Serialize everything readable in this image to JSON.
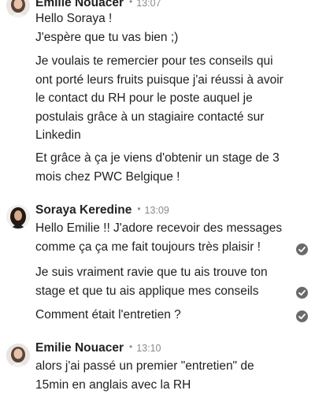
{
  "messages": [
    {
      "sender": "Emilie Nouacer",
      "time": "13:07",
      "lines": [
        "Hello Soraya !",
        "J'espère que tu vas bien ;)",
        "Je voulais te remercier pour tes conseils qui",
        "ont porté leurs fruits puisque j'ai réussi à avoir",
        "le contact du RH pour le poste auquel je",
        "postulais grâce à un stagiaire contacté sur",
        "Linkedin",
        "Et grâce à ça je viens d'obtenir un stage de 3",
        "mois chez PWC Belgique !"
      ]
    },
    {
      "sender": "Soraya Keredine",
      "time": "13:09",
      "lines": [
        "Hello Emilie !! J'adore recevoir des messages",
        "comme ça ça me fait toujours très plaisir !",
        "Je suis vraiment ravie que tu ais trouve ton",
        "stage et que tu ais applique mes conseils",
        "Comment était l'entretien ?"
      ]
    },
    {
      "sender": "Emilie Nouacer",
      "time": "13:10",
      "lines": [
        "alors j'ai passé un premier \"entretien\" de",
        "15min en anglais avec la RH"
      ]
    }
  ],
  "separator": "•",
  "icons": {
    "avatar": "profile-photo",
    "read_receipt": "check-circle-icon"
  },
  "colors": {
    "text": "#1f1f1f",
    "meta": "#8a8a8a",
    "check_bg": "#6a6a6a"
  }
}
